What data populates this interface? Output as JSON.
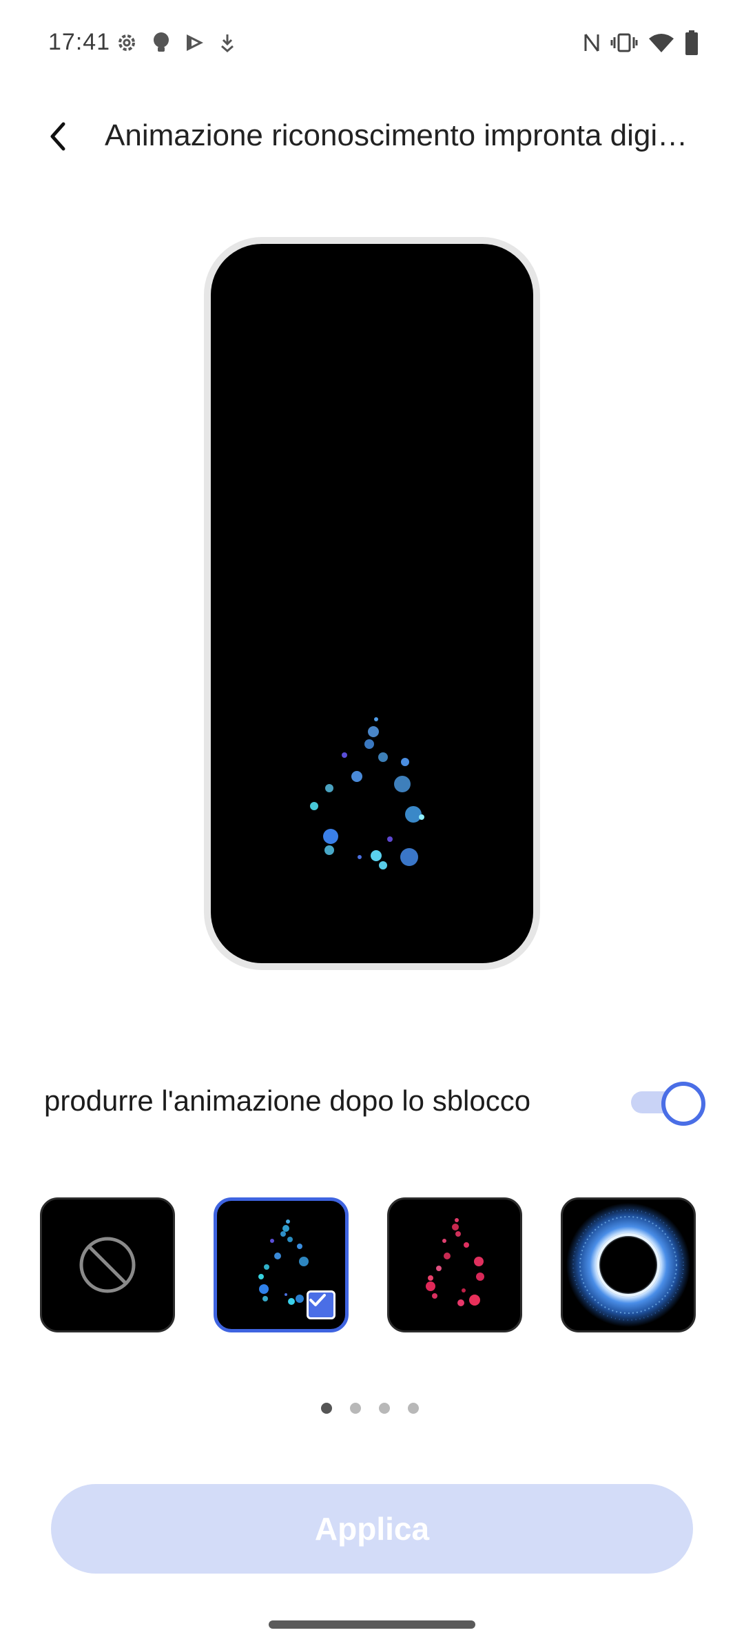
{
  "status_bar": {
    "time": "17:41",
    "left_icons": [
      "settings-icon",
      "lightbulb-icon",
      "play-store-icon",
      "download-arrow-icon"
    ],
    "right_icons": [
      "nfc-icon",
      "vibrate-icon",
      "wifi-icon",
      "battery-icon"
    ]
  },
  "header": {
    "back_icon": "chevron-left-icon",
    "title": "Animazione riconoscimento impronta digi…"
  },
  "preview": {
    "animation": "blue-droplet-particles"
  },
  "settings": {
    "toggle_label": "produrre l'animazione dopo lo sblocco",
    "toggle_on": true
  },
  "options": [
    {
      "name": "none",
      "icon": "prohibited-icon",
      "selected": false
    },
    {
      "name": "blue-droplet",
      "icon": "blue-droplet-icon",
      "selected": true
    },
    {
      "name": "red-droplet",
      "icon": "red-droplet-icon",
      "selected": false
    },
    {
      "name": "blue-ring",
      "icon": "blue-ring-icon",
      "selected": false
    }
  ],
  "pagination": {
    "pages": 4,
    "current": 1
  },
  "apply_button": {
    "label": "Applica"
  },
  "colors": {
    "accent": "#4a6ee6",
    "toggle_track": "#c9d3f6",
    "apply_button_bg": "#d3dcf8"
  }
}
